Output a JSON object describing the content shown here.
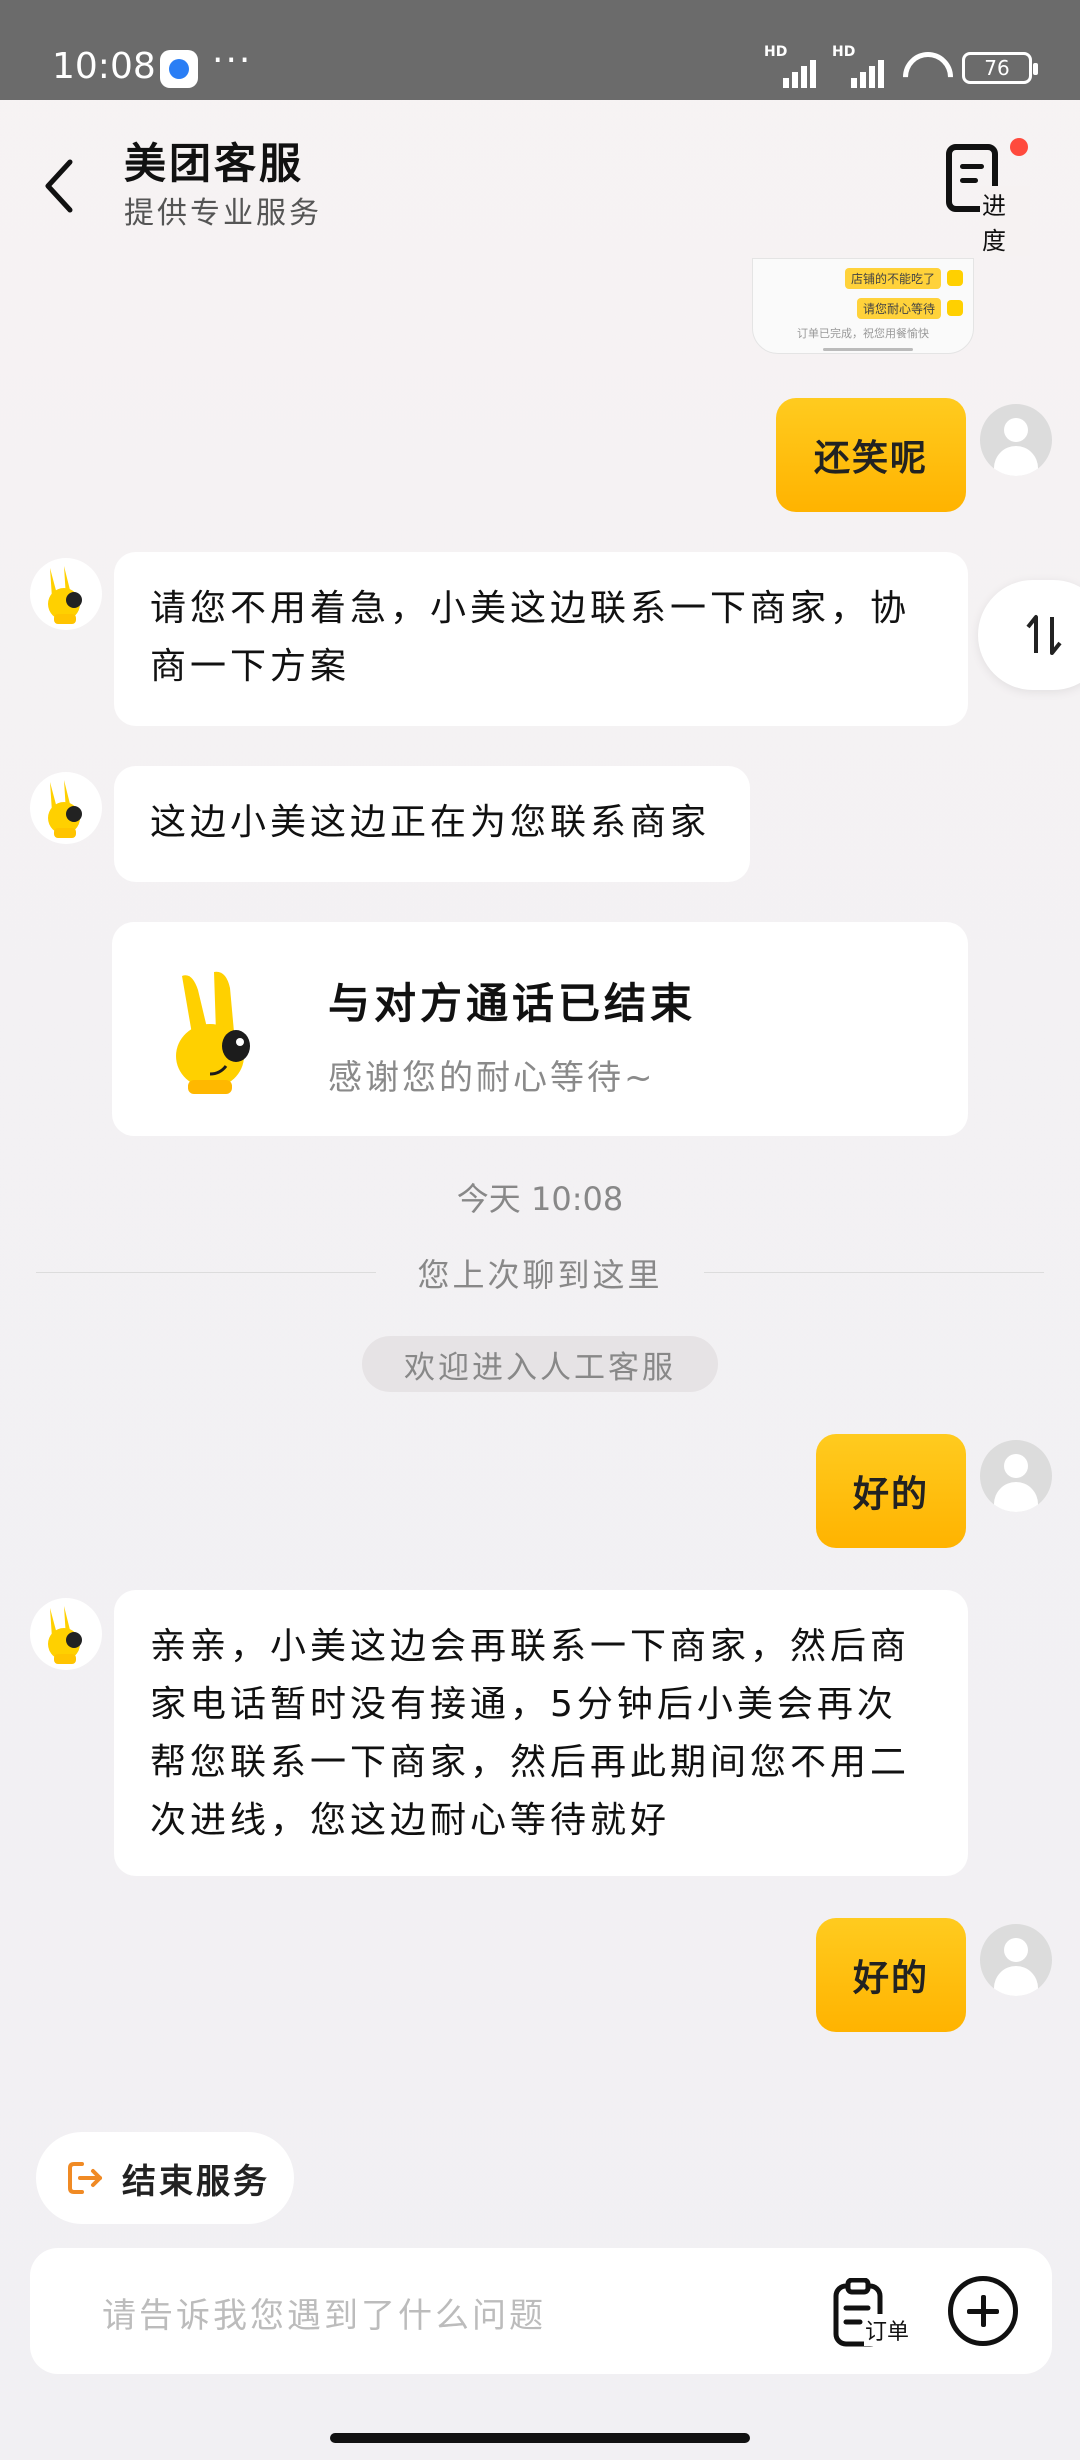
{
  "status_bar": {
    "time": "10:08",
    "dots": "···",
    "network1": "HD",
    "network2": "HD",
    "battery": "76"
  },
  "header": {
    "title": "美团客服",
    "subtitle": "提供专业服务",
    "progress_label": "进度"
  },
  "thumbnail": {
    "row1": "店铺的不能吃了",
    "row2": "请您耐心等待",
    "footer": "订单已完成，祝您用餐愉快"
  },
  "messages": {
    "user1": "还笑呢",
    "bot1": "请您不用着急，小美这边联系一下商家，协商一下方案",
    "bot2": "这边小美这边正在为您联系商家",
    "call_card": {
      "title": "与对方通话已结束",
      "subtitle": "感谢您的耐心等待~"
    },
    "system_time": "今天 10:08",
    "divider": "您上次聊到这里",
    "system_pill": "欢迎进入人工客服",
    "user2": "好的",
    "bot3": "亲亲，小美这边会再联系一下商家，然后商家电话暂时没有接通，5分钟后小美会再次帮您联系一下商家，然后再此期间您不用二次进线，您这边耐心等待就好",
    "user3": "好的"
  },
  "end_service_label": "结束服务",
  "input": {
    "placeholder": "请告诉我您遇到了什么问题",
    "order_label": "订单"
  },
  "colors": {
    "accent": "#FFB300",
    "accent_light": "#FFCB1F",
    "end_icon": "#F08A24"
  }
}
